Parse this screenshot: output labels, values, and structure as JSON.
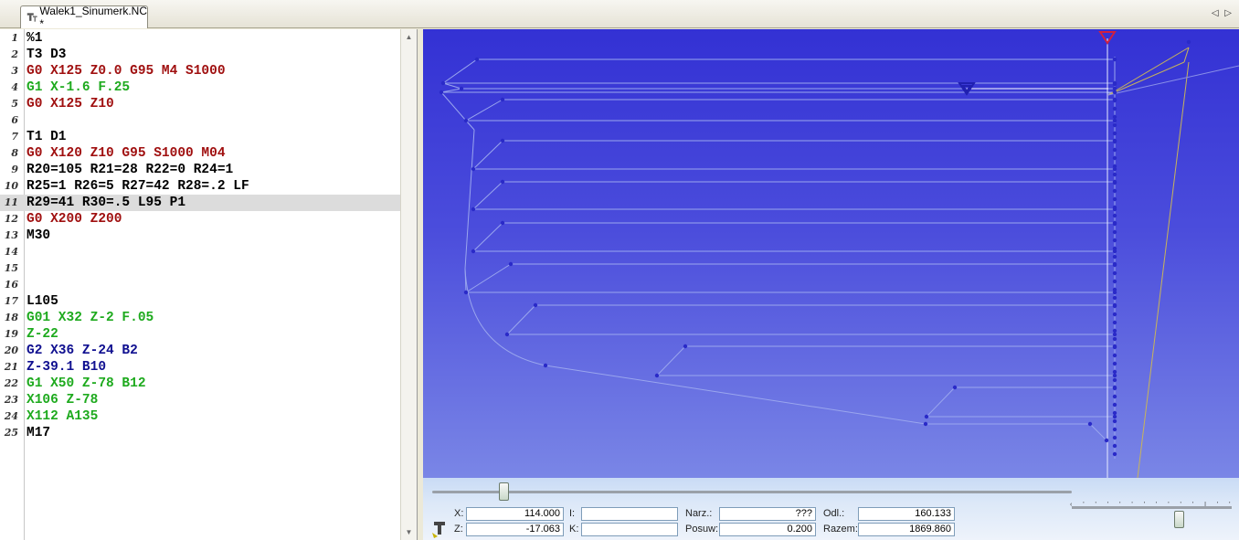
{
  "tab": {
    "title": "Walek1_Sinumerk.NC *",
    "nav_prev": "◁",
    "nav_next": "▷"
  },
  "editor": {
    "lines": [
      {
        "n": "1",
        "text": "%1",
        "color": "#000000"
      },
      {
        "n": "2",
        "text": "T3 D3",
        "color": "#000000"
      },
      {
        "n": "3",
        "text": "G0 X125 Z0.0 G95 M4 S1000",
        "color": "#a01010"
      },
      {
        "n": "4",
        "text": "G1 X-1.6 F.25",
        "color": "#1eaa1e"
      },
      {
        "n": "5",
        "text": "G0 X125 Z10",
        "color": "#a01010"
      },
      {
        "n": "6",
        "text": "",
        "color": "#000000"
      },
      {
        "n": "7",
        "text": "T1 D1",
        "color": "#000000"
      },
      {
        "n": "8",
        "text": "G0 X120 Z10 G95 S1000 M04",
        "color": "#a01010"
      },
      {
        "n": "9",
        "text": "R20=105 R21=28 R22=0 R24=1",
        "color": "#000000"
      },
      {
        "n": "10",
        "text": "R25=1 R26=5 R27=42 R28=.2 LF",
        "color": "#000000"
      },
      {
        "n": "11",
        "text": "R29=41 R30=.5 L95 P1",
        "color": "#000000"
      },
      {
        "n": "12",
        "text": "G0 X200 Z200",
        "color": "#a01010"
      },
      {
        "n": "13",
        "text": "M30",
        "color": "#000000"
      },
      {
        "n": "14",
        "text": "",
        "color": "#000000"
      },
      {
        "n": "15",
        "text": "",
        "color": "#000000"
      },
      {
        "n": "16",
        "text": "",
        "color": "#000000"
      },
      {
        "n": "17",
        "text": "L105",
        "color": "#000000"
      },
      {
        "n": "18",
        "text": "G01 X32 Z-2 F.05",
        "color": "#1eaa1e"
      },
      {
        "n": "19",
        "text": "Z-22",
        "color": "#1eaa1e"
      },
      {
        "n": "20",
        "text": "G2 X36 Z-24 B2",
        "color": "#101090"
      },
      {
        "n": "21",
        "text": "Z-39.1 B10",
        "color": "#101090"
      },
      {
        "n": "22",
        "text": "G1 X50 Z-78 B12",
        "color": "#1eaa1e"
      },
      {
        "n": "23",
        "text": "X106 Z-78",
        "color": "#1eaa1e"
      },
      {
        "n": "24",
        "text": "X112 A135",
        "color": "#1eaa1e"
      },
      {
        "n": "25",
        "text": "M17",
        "color": "#000000"
      }
    ],
    "active_line": "11",
    "scroll_up": "▲",
    "scroll_down": "▼"
  },
  "status": {
    "x_label": "X:",
    "x_value": "114.000",
    "z_label": "Z:",
    "z_value": "-17.063",
    "i_label": "I:",
    "i_value": "",
    "k_label": "K:",
    "k_value": "",
    "tool_label": "Narz.:",
    "tool_value": "???",
    "feed_label": "Posuw:",
    "feed_value": "0.200",
    "dist_label": "Odl.:",
    "dist_value": "160.133",
    "total_label": "Razem:",
    "total_value": "1869.860"
  },
  "colors": {
    "view_bg_top": "#3331d4",
    "view_bg_bottom": "#7a86e6",
    "toolpath": "#9aa6ee",
    "point": "#2a2ac8",
    "rapid": "#c8b45a",
    "tool_marker": "#d02040"
  },
  "icons": {
    "file_icon": "tool-file-icon",
    "tool_icon": "lathe-tool-icon"
  }
}
